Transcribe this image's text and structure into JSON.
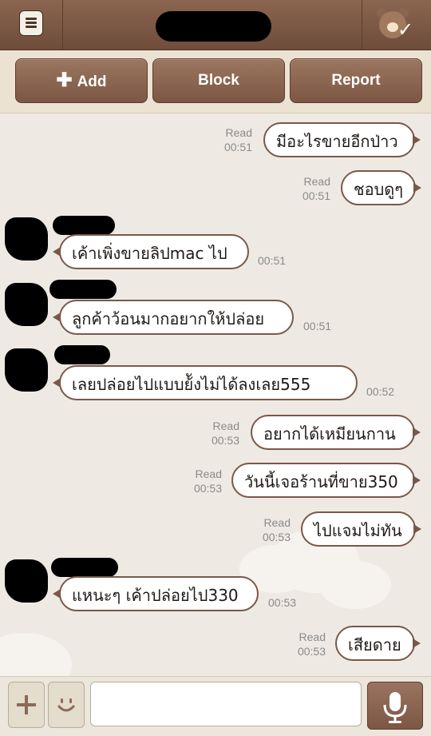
{
  "header": {
    "chat_title": "",
    "menu_icon": "menu-icon",
    "bear_icon": "bear-check-icon"
  },
  "actions": {
    "add_label": "Add",
    "block_label": "Block",
    "report_label": "Report"
  },
  "messages": [
    {
      "dir": "out",
      "text": "มีอะไรขายอีกป่าว",
      "status": "Read",
      "time": "00:51"
    },
    {
      "dir": "out",
      "text": "ชอบดูๆ",
      "status": "Read",
      "time": "00:51"
    },
    {
      "dir": "in",
      "text": "เค้าเพิ่งขายลิปmac ไป",
      "time": "00:51"
    },
    {
      "dir": "in",
      "text": "ลูกค้าว้อนมากอยากให้ปล่อย",
      "time": "00:51"
    },
    {
      "dir": "in",
      "text": "เลยปล่อยไปแบบย้ังไม่ได้ลงเลย555",
      "time": "00:52"
    },
    {
      "dir": "out",
      "text": "อยากได้เหมียนกาน",
      "status": "Read",
      "time": "00:53"
    },
    {
      "dir": "out",
      "text": "วันนี้เจอร้านที่ขาย350",
      "status": "Read",
      "time": "00:53"
    },
    {
      "dir": "out",
      "text": "ไปแจมไม่ทัน",
      "status": "Read",
      "time": "00:53"
    },
    {
      "dir": "in",
      "text": "แหนะๆ เค้าปล่อยไป330",
      "time": "00:53"
    },
    {
      "dir": "out",
      "text": "เสียดาย",
      "status": "Read",
      "time": "00:53"
    }
  ],
  "input": {
    "value": "",
    "placeholder": "",
    "plus_icon": "plus-icon",
    "sticker_icon": "smiley-icon",
    "mic_icon": "microphone-icon"
  },
  "colors": {
    "header": "#7a5848",
    "bubble_border": "#7a5848",
    "background": "#eeeae3"
  }
}
